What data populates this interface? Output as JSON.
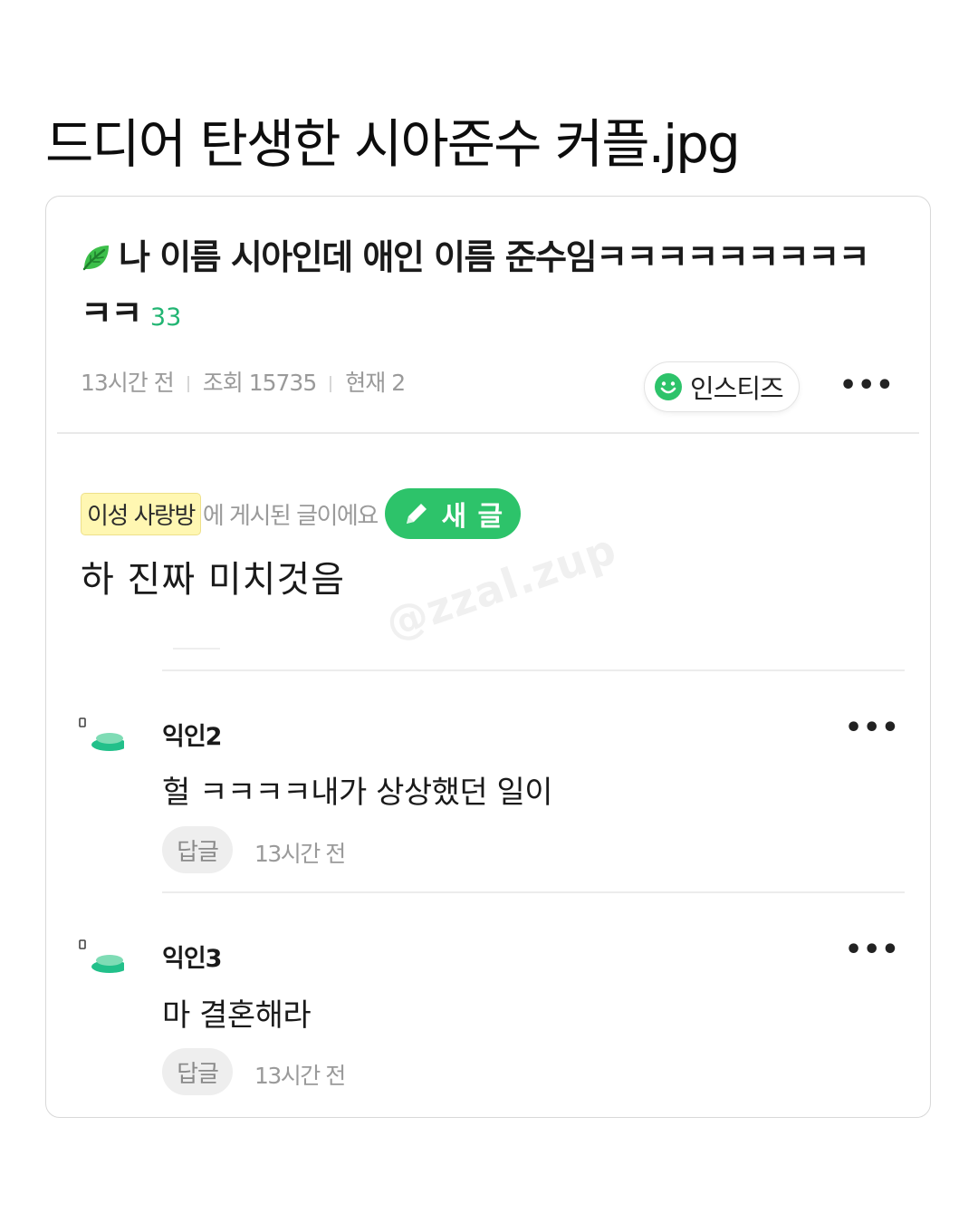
{
  "page": {
    "heading": "드디어 탄생한 시아준수 커플.jpg"
  },
  "post": {
    "title": "나 이름 시아인데 애인 이름 준수임ㅋㅋㅋㅋㅋㅋㅋㅋㅋㅋㅋ",
    "comment_count": "33",
    "time": "13시간 전",
    "views": "조회 15735",
    "current": "현재 2",
    "share_label": "인스티즈",
    "board_name": "이성 사랑방",
    "board_suffix": "에 게시된 글이에요",
    "new_post_label": "새 글",
    "body": "하 진짜 미치것음",
    "watermark": "@zzal.zup",
    "more_glyph": "•••"
  },
  "comments": [
    {
      "author": "익인2",
      "text": "헐 ㅋㅋㅋㅋ내가 상상했던 일이",
      "reply_label": "답글",
      "time": "13시간 전"
    },
    {
      "author": "익인3",
      "text": "마 결혼해라",
      "reply_label": "답글",
      "time": "13시간 전"
    }
  ],
  "colors": {
    "accent_green": "#2dc36a",
    "count_green": "#22b573",
    "board_chip_bg": "#fff7b2"
  },
  "icons": {
    "title_icon": "leaf-icon",
    "share_icon": "smiley-icon",
    "new_post_icon": "pencil-icon",
    "comment_avatar": "avatar-icon"
  }
}
